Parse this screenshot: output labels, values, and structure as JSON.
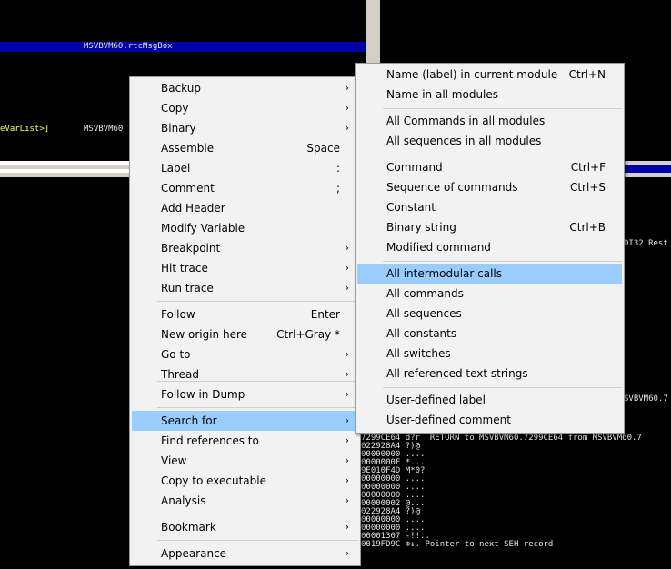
{
  "background": {
    "top_left_line1": "MSVBVM60.rtcMsgBox",
    "top_left_line2_left": "eVarList>]",
    "top_left_line2_right": "MSVBVM60",
    "right_snippet_1": "DI32.Rest",
    "right_snippet_2": "SVBVM60.7",
    "right_snippet_3": "SVBVM60.7",
    "stack_lines": [
      "7299CE64 d?r  RETURN to MSVBVM60.7299CE64 from MSVBVM60.7",
      "022928A4 ?)@",
      "00000000 ....",
      "0000000F *...",
      "9E010F4D M*0?",
      "00000000 ....",
      "00000000 ....",
      "00000000 ....",
      "00000002 @...",
      "022928A4 ?)@",
      "00000000 ....",
      "00000000 ....",
      "00001307 -!!..",
      "0019FD9C ⊕↓. Pointer to next SEH record"
    ]
  },
  "context_menu": {
    "items": [
      {
        "label": "Backup",
        "shortcut": "",
        "submenu": true
      },
      {
        "label": "Copy",
        "shortcut": "",
        "submenu": true
      },
      {
        "label": "Binary",
        "shortcut": "",
        "submenu": true
      },
      {
        "label": "Assemble",
        "shortcut": "Space",
        "submenu": false
      },
      {
        "label": "Label",
        "shortcut": ":",
        "submenu": false
      },
      {
        "label": "Comment",
        "shortcut": ";",
        "submenu": false
      },
      {
        "label": "Add Header",
        "shortcut": "",
        "submenu": false
      },
      {
        "label": "Modify Variable",
        "shortcut": "",
        "submenu": false
      },
      {
        "label": "Breakpoint",
        "shortcut": "",
        "submenu": true
      },
      {
        "label": "Hit trace",
        "shortcut": "",
        "submenu": true
      },
      {
        "label": "Run trace",
        "shortcut": "",
        "submenu": true
      },
      {
        "label": "Follow",
        "shortcut": "Enter",
        "submenu": false
      },
      {
        "label": "New origin here",
        "shortcut": "Ctrl+Gray *",
        "submenu": false
      },
      {
        "label": "Go to",
        "shortcut": "",
        "submenu": true
      },
      {
        "label": "Thread",
        "shortcut": "",
        "submenu": true
      },
      {
        "label": "Follow in Dump",
        "shortcut": "",
        "submenu": true
      },
      {
        "label": "Search for",
        "shortcut": "",
        "submenu": true
      },
      {
        "label": "Find references to",
        "shortcut": "",
        "submenu": true
      },
      {
        "label": "View",
        "shortcut": "",
        "submenu": true
      },
      {
        "label": "Copy to executable",
        "shortcut": "",
        "submenu": true
      },
      {
        "label": "Analysis",
        "shortcut": "",
        "submenu": true
      },
      {
        "label": "Bookmark",
        "shortcut": "",
        "submenu": true
      },
      {
        "label": "Appearance",
        "shortcut": "",
        "submenu": true
      }
    ],
    "highlighted": "Search for"
  },
  "search_submenu": {
    "items": [
      {
        "label": "Name (label) in current module",
        "shortcut": "Ctrl+N"
      },
      {
        "label": "Name in all modules",
        "shortcut": ""
      },
      {
        "label": "All Commands in all modules",
        "shortcut": ""
      },
      {
        "label": "All sequences in all modules",
        "shortcut": ""
      },
      {
        "label": "Command",
        "shortcut": "Ctrl+F"
      },
      {
        "label": "Sequence of commands",
        "shortcut": "Ctrl+S"
      },
      {
        "label": "Constant",
        "shortcut": ""
      },
      {
        "label": "Binary string",
        "shortcut": "Ctrl+B"
      },
      {
        "label": "Modified command",
        "shortcut": ""
      },
      {
        "label": "All intermodular calls",
        "shortcut": ""
      },
      {
        "label": "All commands",
        "shortcut": ""
      },
      {
        "label": "All sequences",
        "shortcut": ""
      },
      {
        "label": "All constants",
        "shortcut": ""
      },
      {
        "label": "All switches",
        "shortcut": ""
      },
      {
        "label": "All referenced text strings",
        "shortcut": ""
      },
      {
        "label": "User-defined label",
        "shortcut": ""
      },
      {
        "label": "User-defined comment",
        "shortcut": ""
      }
    ],
    "highlighted": "All intermodular calls"
  },
  "icons": {
    "submenu_arrow": "›"
  },
  "colors": {
    "highlight": "#99ccff",
    "menu_bg": "#f2f2f2",
    "selection_bar": "#0000a8"
  }
}
